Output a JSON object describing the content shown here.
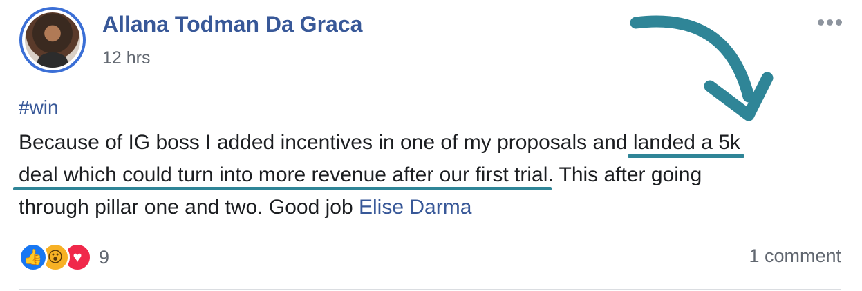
{
  "post": {
    "author": "Allana Todman Da Graca",
    "time": "12 hrs",
    "hashtag": "#win",
    "body": {
      "line1_plain": "Because of IG boss I added incentives in one of my proposals and ",
      "line1_highlight": "landed a 5k",
      "line2_highlight": "deal which could turn into more revenue after our first trial",
      "line2_plain": ". This after going",
      "line3_plain": "through pillar one and two. Good job ",
      "mention": "Elise Darma"
    },
    "reactions": {
      "icons": [
        "like-icon",
        "wow-icon",
        "love-icon"
      ],
      "count": "9"
    },
    "comments_label": "1 comment"
  },
  "colors": {
    "name_link": "#385898",
    "annotation_teal": "#2f8597",
    "text": "#1c1e21",
    "meta": "#616770"
  }
}
